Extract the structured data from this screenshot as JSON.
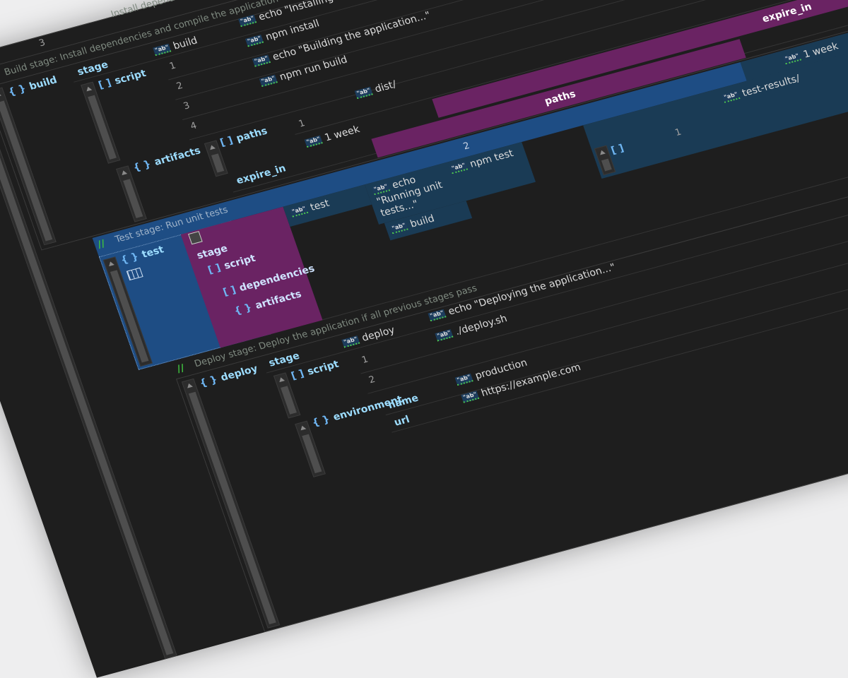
{
  "top": {
    "row_number": "3",
    "comment_partial": "Install dependencies and"
  },
  "build": {
    "comment": "Build stage: Install dependencies and compile the application",
    "key": "build",
    "stage_label": "stage",
    "stage_value": "build",
    "script_label": "script",
    "script_items": [
      {
        "n": "1",
        "v": "echo \"Installing dependencies...\""
      },
      {
        "n": "2",
        "v": "npm install"
      },
      {
        "n": "3",
        "v": "echo \"Building the application...\""
      },
      {
        "n": "4",
        "v": "npm run build"
      }
    ],
    "artifacts_label": "artifacts",
    "paths_label": "paths",
    "paths_n": "1",
    "paths_v": "dist/",
    "expire_label": "expire_in",
    "expire_v": "1 week"
  },
  "overlay": {
    "expire_header": "expire_in",
    "paths_header": "paths",
    "col_2": "2",
    "col_1": "1",
    "expire_value": "1 week",
    "test_results": "test-results/",
    "list_n": "1"
  },
  "test": {
    "comment": "Test stage: Run unit tests",
    "key": "test",
    "stage_label": "stage",
    "script_label": "script",
    "deps_label": "dependencies",
    "artifacts_label": "artifacts",
    "stage_value": "test",
    "script_v1": "echo \"Running unit tests...\"",
    "script_v2": "npm test",
    "deps_value": "build"
  },
  "deploy": {
    "comment": "Deploy stage: Deploy the application if all previous stages pass",
    "key": "deploy",
    "stage_label": "stage",
    "stage_value": "deploy",
    "script_label": "script",
    "script_items": [
      {
        "n": "1",
        "v": "echo \"Deploying the application...\""
      },
      {
        "n": "2",
        "v": "./deploy.sh"
      }
    ],
    "env_label": "environment",
    "name_label": "name",
    "name_v": "production",
    "url_label": "url",
    "url_v": "https://example.com"
  },
  "icons": {
    "object": "{ }",
    "array": "[ ]",
    "string": "\"ab\""
  },
  "colors": {
    "selection": "#1e4d84",
    "highlight": "#6a2363",
    "key": "#9cdcfe",
    "comment_slash": "#3fbf3f"
  }
}
